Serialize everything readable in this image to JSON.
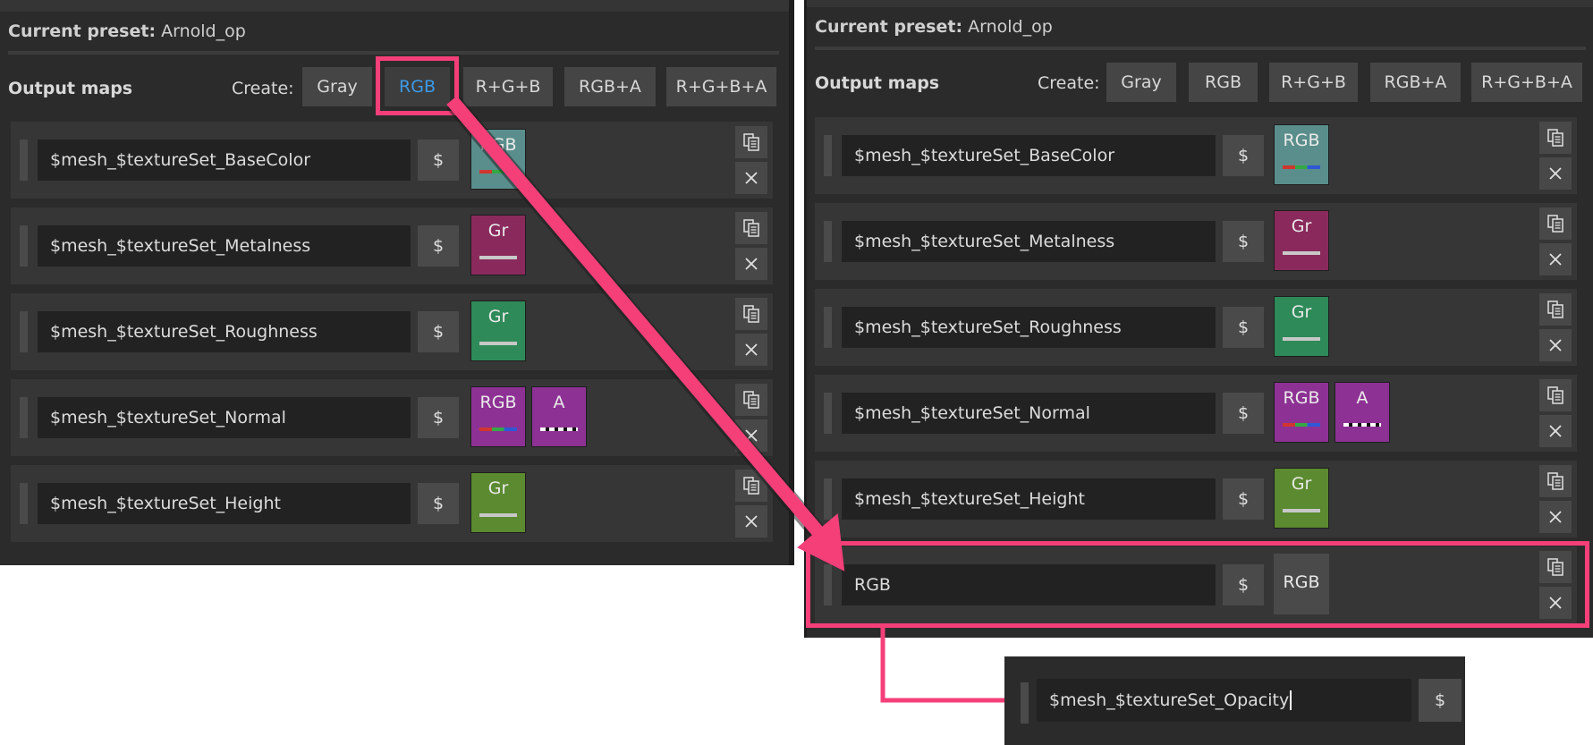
{
  "preset": {
    "label": "Current preset:",
    "value": "Arnold_op"
  },
  "output_maps_label": "Output maps",
  "create_label": "Create:",
  "create_buttons": [
    "Gray",
    "RGB",
    "R+G+B",
    "RGB+A",
    "R+G+B+A"
  ],
  "dollar_label": "$",
  "maps": [
    {
      "name": "$mesh_$textureSet_BaseColor",
      "chips": [
        {
          "text": "RGB",
          "bar": "rgb",
          "color": "#5a8e8c"
        }
      ]
    },
    {
      "name": "$mesh_$textureSet_Metalness",
      "chips": [
        {
          "text": "Gr",
          "bar": "gray",
          "color": "#8a2a5c"
        }
      ]
    },
    {
      "name": "$mesh_$textureSet_Roughness",
      "chips": [
        {
          "text": "Gr",
          "bar": "gray",
          "color": "#2e8a59"
        }
      ]
    },
    {
      "name": "$mesh_$textureSet_Normal",
      "chips": [
        {
          "text": "RGB",
          "bar": "rgb",
          "color": "#8d3294"
        },
        {
          "text": "A",
          "bar": "alpha",
          "color": "#8d3294"
        }
      ]
    },
    {
      "name": "$mesh_$textureSet_Height",
      "chips": [
        {
          "text": "Gr",
          "bar": "gray",
          "color": "#5b8a30"
        }
      ]
    }
  ],
  "new_map": {
    "name": "RGB",
    "chip_text": "RGB"
  },
  "callout": {
    "name": "$mesh_$textureSet_Opacity"
  },
  "colors": {
    "highlight": "#f43f79",
    "active_button": "#3a9ae8"
  }
}
